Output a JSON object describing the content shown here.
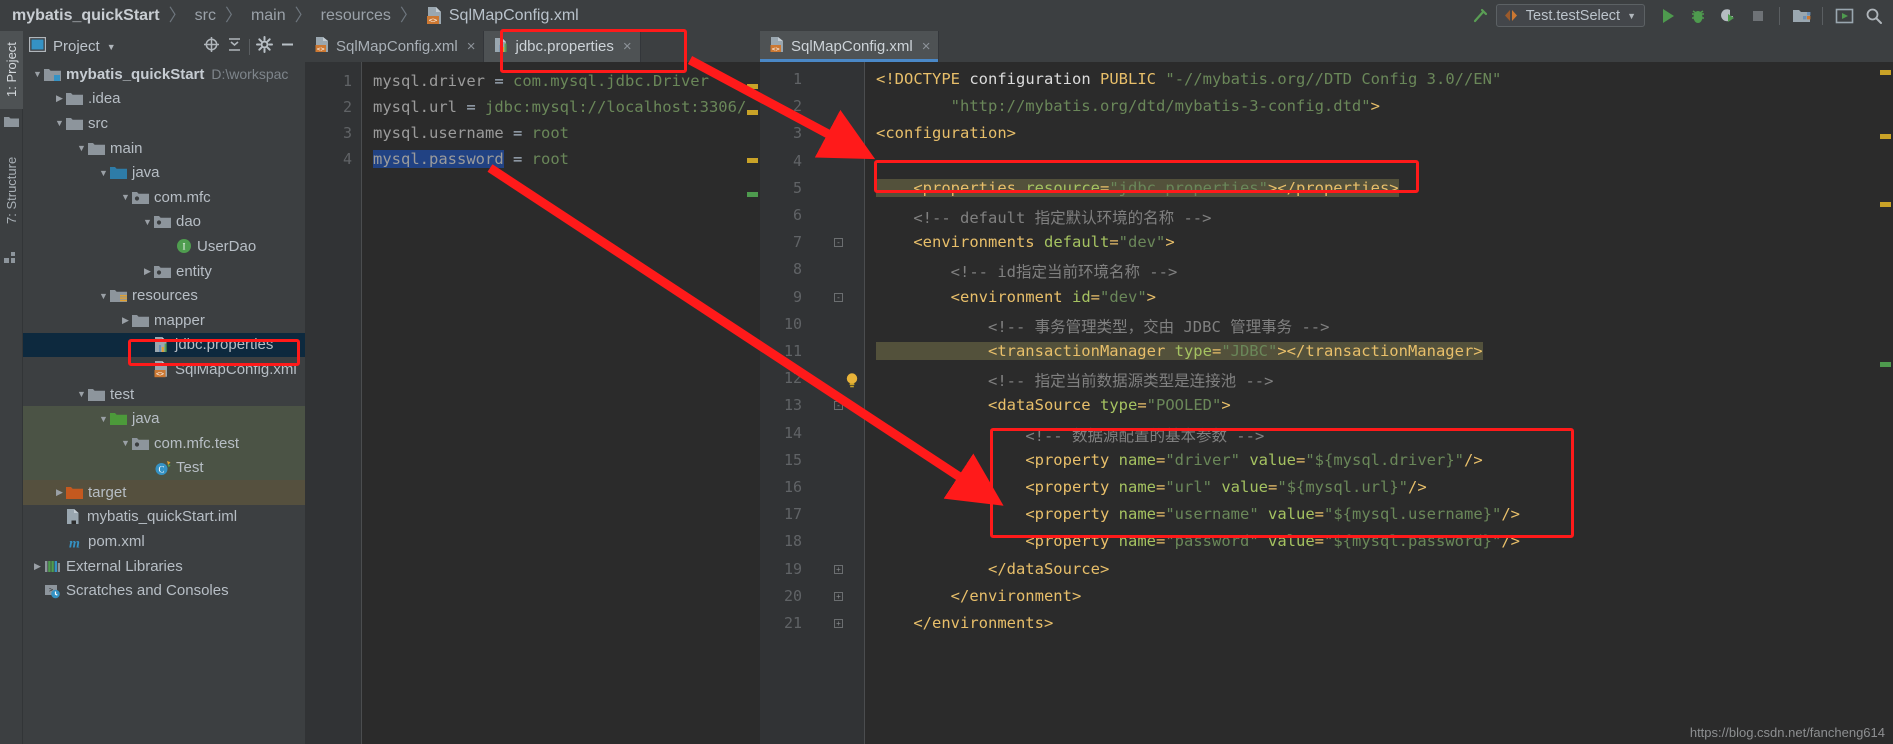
{
  "breadcrumb": {
    "items": [
      "mybatis_quickStart",
      "src",
      "main",
      "resources"
    ],
    "file": "SqlMapConfig.xml",
    "separator": "〉"
  },
  "toolbar": {
    "run_config": "Test.testSelect",
    "icons": [
      "hammer-icon",
      "run-icon",
      "debug-icon",
      "run-coverage-icon",
      "stop-icon",
      "project-structure-icon",
      "select-run-icon",
      "search-icon"
    ]
  },
  "left_stripe": {
    "tabs": [
      "1: Project",
      "7: Structure"
    ]
  },
  "project_panel": {
    "title": "Project",
    "caret": "▼",
    "tree": [
      {
        "indent": 0,
        "arrow": "▼",
        "icon": "module-folder-icon",
        "label": "mybatis_quickStart",
        "sub": "D:\\workspac",
        "bold": true,
        "bg": "none"
      },
      {
        "indent": 1,
        "arrow": "▶",
        "icon": "folder-icon",
        "label": ".idea",
        "sub": "",
        "bold": false,
        "bg": "none"
      },
      {
        "indent": 1,
        "arrow": "▼",
        "icon": "folder-icon",
        "label": "src",
        "sub": "",
        "bold": false,
        "bg": "none"
      },
      {
        "indent": 2,
        "arrow": "▼",
        "icon": "folder-icon",
        "label": "main",
        "sub": "",
        "bold": false,
        "bg": "none"
      },
      {
        "indent": 3,
        "arrow": "▼",
        "icon": "source-root-icon",
        "label": "java",
        "sub": "",
        "bold": false,
        "bg": "none"
      },
      {
        "indent": 4,
        "arrow": "▼",
        "icon": "package-icon",
        "label": "com.mfc",
        "sub": "",
        "bold": false,
        "bg": "none"
      },
      {
        "indent": 5,
        "arrow": "▼",
        "icon": "package-icon",
        "label": "dao",
        "sub": "",
        "bold": false,
        "bg": "none"
      },
      {
        "indent": 6,
        "arrow": "",
        "icon": "interface-icon",
        "label": "UserDao",
        "sub": "",
        "bold": false,
        "bg": "none"
      },
      {
        "indent": 5,
        "arrow": "▶",
        "icon": "package-icon",
        "label": "entity",
        "sub": "",
        "bold": false,
        "bg": "none"
      },
      {
        "indent": 3,
        "arrow": "▼",
        "icon": "resource-root-icon",
        "label": "resources",
        "sub": "",
        "bold": false,
        "bg": "none"
      },
      {
        "indent": 4,
        "arrow": "▶",
        "icon": "folder-icon",
        "label": "mapper",
        "sub": "",
        "bold": false,
        "bg": "none"
      },
      {
        "indent": 5,
        "arrow": "",
        "icon": "properties-file-icon",
        "label": "jdbc.properties",
        "sub": "",
        "bold": false,
        "bg": "selected"
      },
      {
        "indent": 5,
        "arrow": "",
        "icon": "xml-file-icon",
        "label": "SqlMapConfig.xml",
        "sub": "",
        "bold": false,
        "bg": "none"
      },
      {
        "indent": 2,
        "arrow": "▼",
        "icon": "folder-icon",
        "label": "test",
        "sub": "",
        "bold": false,
        "bg": "none"
      },
      {
        "indent": 3,
        "arrow": "▼",
        "icon": "test-source-root-icon",
        "label": "java",
        "sub": "",
        "bold": false,
        "bg": "green"
      },
      {
        "indent": 4,
        "arrow": "▼",
        "icon": "package-icon",
        "label": "com.mfc.test",
        "sub": "",
        "bold": false,
        "bg": "green"
      },
      {
        "indent": 5,
        "arrow": "",
        "icon": "test-class-icon",
        "label": "Test",
        "sub": "",
        "bold": false,
        "bg": "green"
      },
      {
        "indent": 1,
        "arrow": "▶",
        "icon": "excluded-folder-icon",
        "label": "target",
        "sub": "",
        "bold": false,
        "bg": "brown"
      },
      {
        "indent": 1,
        "arrow": "",
        "icon": "iml-file-icon",
        "label": "mybatis_quickStart.iml",
        "sub": "",
        "bold": false,
        "bg": "none"
      },
      {
        "indent": 1,
        "arrow": "",
        "icon": "maven-file-icon",
        "label": "pom.xml",
        "sub": "",
        "bold": false,
        "bg": "none"
      },
      {
        "indent": 0,
        "arrow": "▶",
        "icon": "external-libraries-icon",
        "label": "External Libraries",
        "sub": "",
        "bold": false,
        "bg": "none"
      },
      {
        "indent": 0,
        "arrow": "",
        "icon": "scratches-icon",
        "label": "Scratches and Consoles",
        "sub": "",
        "bold": false,
        "bg": "none"
      }
    ]
  },
  "editor_left": {
    "tabs": [
      {
        "label": "SqlMapConfig.xml",
        "icon": "xml-file-icon",
        "active": false,
        "close": "×"
      },
      {
        "label": "jdbc.properties",
        "icon": "properties-file-icon",
        "active": true,
        "close": "×"
      }
    ],
    "line_numbers": [
      "1",
      "2",
      "3",
      "4"
    ],
    "lines": [
      {
        "n": 1,
        "parts": [
          {
            "t": "mysql.driver",
            "c": "t-gray"
          },
          {
            "t": " = ",
            "c": "t-plain"
          },
          {
            "t": "com.mysql.jdbc.Driver",
            "c": "t-str"
          }
        ]
      },
      {
        "n": 2,
        "parts": [
          {
            "t": "mysql.url",
            "c": "t-gray"
          },
          {
            "t": " = ",
            "c": "t-plain"
          },
          {
            "t": "jdbc:mysql://localhost:3306/",
            "c": "t-str"
          }
        ]
      },
      {
        "n": 3,
        "parts": [
          {
            "t": "mysql.username",
            "c": "t-gray"
          },
          {
            "t": " = ",
            "c": "t-plain"
          },
          {
            "t": "root",
            "c": "t-str"
          }
        ]
      },
      {
        "n": 4,
        "parts": [
          {
            "t": "mysql.password",
            "c": "t-sel"
          },
          {
            "t": " = ",
            "c": "t-plain"
          },
          {
            "t": "root",
            "c": "t-str"
          }
        ]
      }
    ]
  },
  "editor_right": {
    "tabs": [
      {
        "label": "SqlMapConfig.xml",
        "icon": "xml-file-icon",
        "active": true,
        "close": "×"
      }
    ],
    "line_numbers": [
      "1",
      "2",
      "3",
      "4",
      "5",
      "6",
      "7",
      "8",
      "9",
      "10",
      "11",
      "12",
      "13",
      "14",
      "15",
      "16",
      "17",
      "18",
      "19",
      "20",
      "21"
    ],
    "lines": [
      {
        "n": 1,
        "text": "<!DOCTYPE configuration PUBLIC \"-//mybatis.org//DTD Config 3.0//EN\""
      },
      {
        "n": 2,
        "text": "        \"http://mybatis.org/dtd/mybatis-3-config.dtd\">"
      },
      {
        "n": 3,
        "text": "<configuration>"
      },
      {
        "n": 4,
        "text": ""
      },
      {
        "n": 5,
        "text": "    <properties resource=\"jdbc.properties\"></properties>"
      },
      {
        "n": 6,
        "text": "    <!-- default 指定默认环境的名称 -->"
      },
      {
        "n": 7,
        "text": "    <environments default=\"dev\">"
      },
      {
        "n": 8,
        "text": "        <!-- id指定当前环境名称 -->"
      },
      {
        "n": 9,
        "text": "        <environment id=\"dev\">"
      },
      {
        "n": 10,
        "text": "            <!-- 事务管理类型，交由 JDBC 管理事务 -->"
      },
      {
        "n": 11,
        "text": "            <transactionManager type=\"JDBC\"></transactionManager>"
      },
      {
        "n": 12,
        "text": "            <!-- 指定当前数据源类型是连接池 -->"
      },
      {
        "n": 13,
        "text": "            <dataSource type=\"POOLED\">"
      },
      {
        "n": 14,
        "text": "                <!-- 数据源配置的基本参数 -->"
      },
      {
        "n": 15,
        "text": "                <property name=\"driver\" value=\"${mysql.driver}\"/>"
      },
      {
        "n": 16,
        "text": "                <property name=\"url\" value=\"${mysql.url}\"/>"
      },
      {
        "n": 17,
        "text": "                <property name=\"username\" value=\"${mysql.username}\"/>"
      },
      {
        "n": 18,
        "text": "                <property name=\"password\" value=\"${mysql.password}\"/>"
      },
      {
        "n": 19,
        "text": "            </dataSource>"
      },
      {
        "n": 20,
        "text": "        </environment>"
      },
      {
        "n": 21,
        "text": "    </environments>"
      }
    ]
  },
  "annotations": {
    "boxes": [
      "jdbc-properties-tree-node",
      "jdbc-properties-tab",
      "properties-resource-line",
      "property-placeholder-block"
    ],
    "arrows": [
      "arrow-tab-to-properties-line",
      "arrow-password-to-property-block"
    ],
    "color": "#ff1a1a"
  },
  "watermark": "https://blog.csdn.net/fancheng614",
  "colors": {
    "editor_bg": "#2b2b2b",
    "panel_bg": "#3c3f41",
    "gutter_bg": "#313335",
    "accent": "#4a88c7",
    "annotation_red": "#ff1a1a",
    "selection": "#214283",
    "tree_selected": "#0d293e"
  }
}
